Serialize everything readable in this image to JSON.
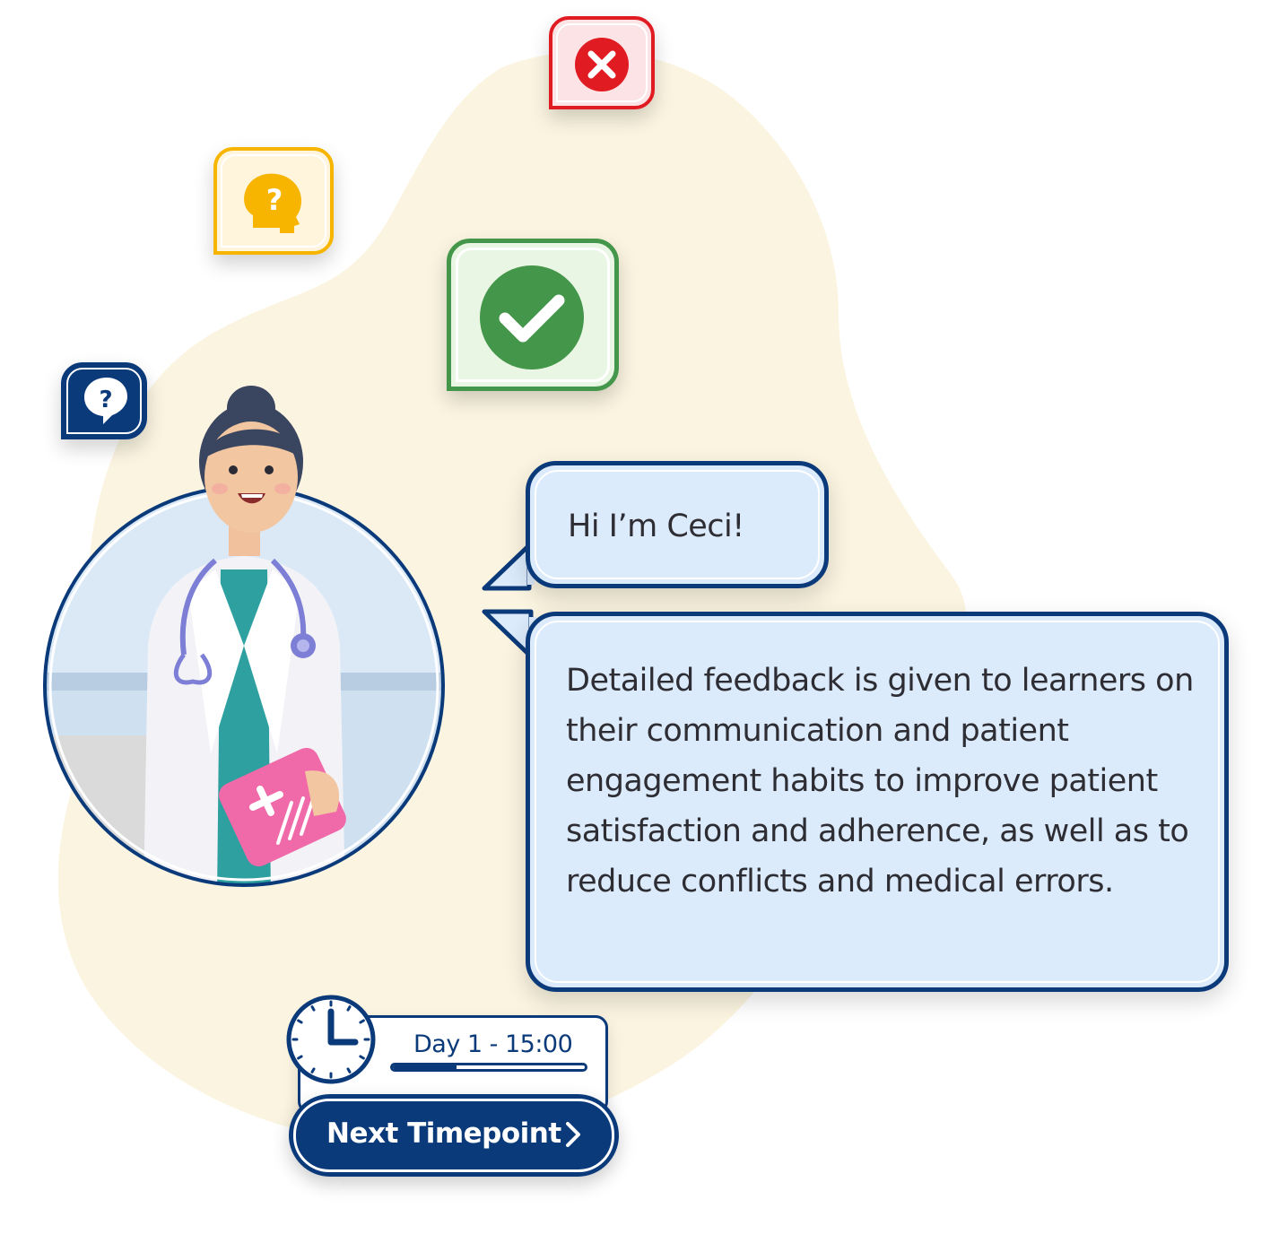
{
  "theme": {
    "navy": "#0b3a7a",
    "bubble_fill": "#dcebfb",
    "blob_fill": "#fbf4e0",
    "wrong_red": "#e11b22",
    "unsure_yellow": "#f7b500",
    "correct_green": "#43964a"
  },
  "badges": {
    "wrong": "close-icon",
    "unsure": "head-question-icon",
    "correct": "checkmark-icon",
    "question": "question-bubble-icon"
  },
  "character": {
    "illustration": "doctor-avatar"
  },
  "chat": {
    "greeting": "Hi I’m Ceci!",
    "message": "Detailed feedback is given to learners on their communication and patient engagement habits to improve patient satisfaction and adherence, as well as to reduce conflicts and medical errors."
  },
  "timepoint": {
    "label": "Day 1 - 15:00",
    "progress": 0.33,
    "button_label": "Next Timepoint",
    "button_icon": "chevron-right-icon",
    "clock_icon": "clock-icon"
  }
}
